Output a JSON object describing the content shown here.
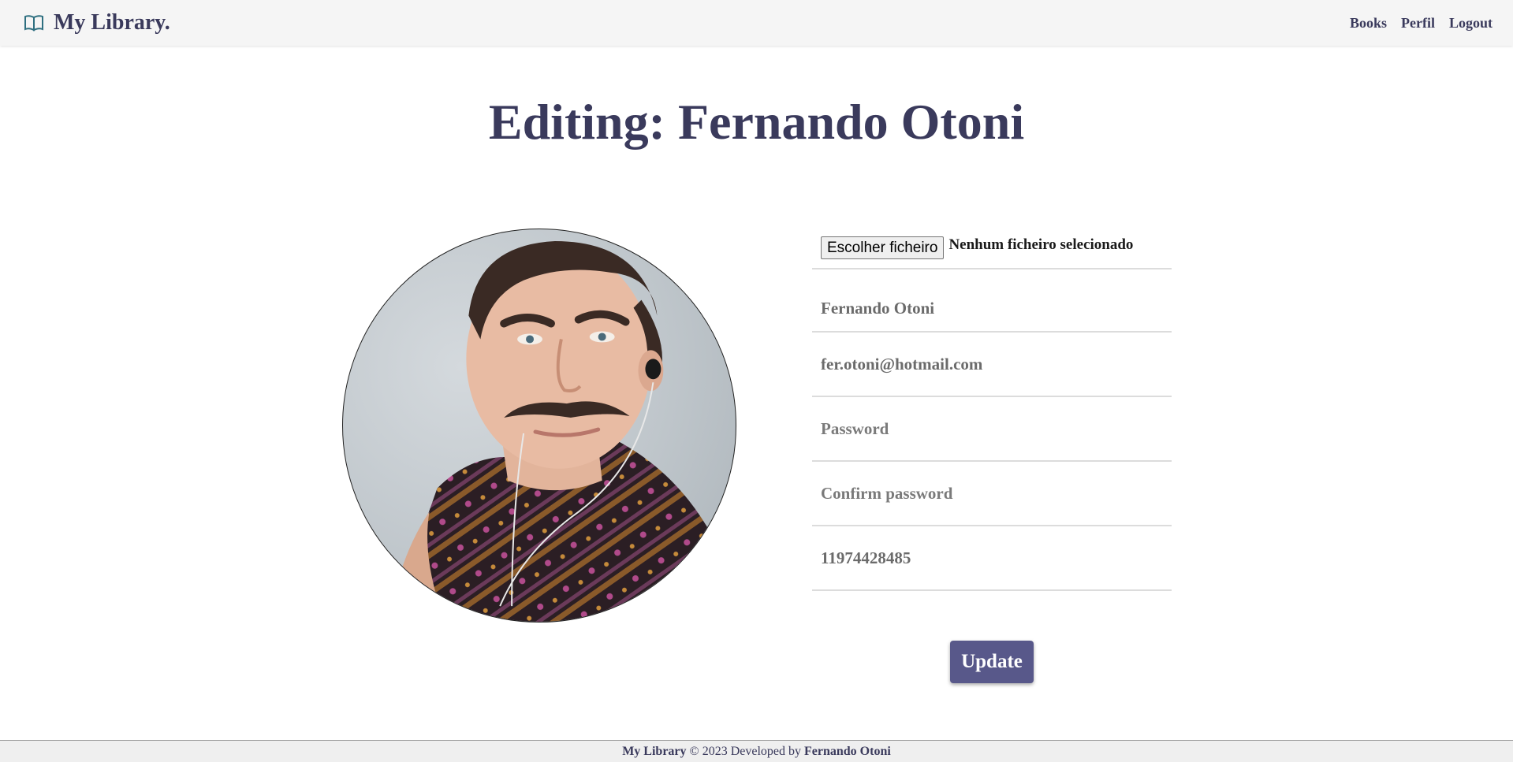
{
  "navbar": {
    "brand": "My Library.",
    "brand_icon": "open-book-icon",
    "links": [
      "Books",
      "Perfil",
      "Logout"
    ]
  },
  "page": {
    "title": "Editing: Fernando Otoni"
  },
  "avatar": {
    "alt": "profile-photo"
  },
  "form": {
    "file_button": "Escolher ficheiro",
    "file_status": "Nenhum ficheiro selecionado",
    "name_value": "Fernando Otoni",
    "email_value": "fer.otoni@hotmail.com",
    "password_placeholder": "Password",
    "confirm_placeholder": "Confirm password",
    "phone_value": "11974428485",
    "update_label": "Update"
  },
  "footer": {
    "brand": "My Library",
    "copyright": "© 2023 Developed by",
    "author": "Fernando Otoni"
  },
  "colors": {
    "primary": "#3a3a5c",
    "button": "#58588a",
    "navbar_bg": "#f5f5f5"
  }
}
